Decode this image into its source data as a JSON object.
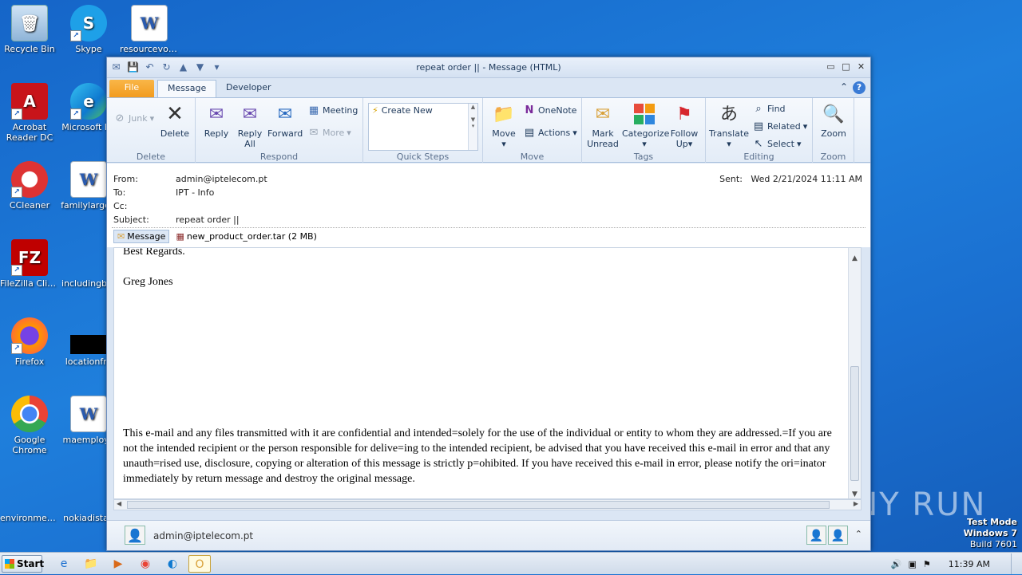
{
  "desktop": {
    "icons": [
      {
        "label": "Recycle Bin"
      },
      {
        "label": "Skype"
      },
      {
        "label": "resourcevol..."
      },
      {
        "label": "Acrobat Reader DC"
      },
      {
        "label": "Microsoft Ed"
      },
      {
        "label": "CCleaner"
      },
      {
        "label": "familylarge.r"
      },
      {
        "label": "FileZilla Client"
      },
      {
        "label": "includingbro"
      },
      {
        "label": "Firefox"
      },
      {
        "label": "locationfro"
      },
      {
        "label": "Google Chrome"
      },
      {
        "label": "maemploye"
      },
      {
        "label": "environmen..."
      },
      {
        "label": "nokiadistan"
      }
    ],
    "watermark": "ANY RUN",
    "test_mode": {
      "line1": "Test Mode",
      "line2": "Windows 7",
      "line3": "Build 7601"
    }
  },
  "window": {
    "title": "repeat order ||   -  Message (HTML)",
    "tabs": {
      "file": "File",
      "message": "Message",
      "developer": "Developer"
    },
    "ribbon": {
      "delete_group": {
        "junk": "Junk",
        "delete": "Delete",
        "label": "Delete"
      },
      "respond_group": {
        "reply": "Reply",
        "reply_all_1": "Reply",
        "reply_all_2": "All",
        "forward": "Forward",
        "meeting": "Meeting",
        "more": "More",
        "label": "Respond"
      },
      "quick_steps": {
        "create_new": "Create New",
        "label": "Quick Steps"
      },
      "move_group": {
        "move": "Move",
        "onenote": "OneNote",
        "actions": "Actions",
        "label": "Move"
      },
      "tags_group": {
        "mark_unread_1": "Mark",
        "mark_unread_2": "Unread",
        "categorize": "Categorize",
        "follow_up_1": "Follow",
        "follow_up_2": "Up",
        "label": "Tags"
      },
      "editing_group": {
        "translate": "Translate",
        "find": "Find",
        "related": "Related",
        "select": "Select",
        "label": "Editing"
      },
      "zoom_group": {
        "zoom": "Zoom",
        "label": "Zoom"
      }
    },
    "header": {
      "from_label": "From:",
      "from": "admin@iptelecom.pt",
      "to_label": "To:",
      "to": "IPT - Info",
      "cc_label": "Cc:",
      "cc": "",
      "subject_label": "Subject:",
      "subject": "repeat order ||",
      "sent_label": "Sent:",
      "sent": "Wed 2/21/2024 11:11 AM",
      "message_tab": "Message",
      "attachment": "new_product_order.tar (2 MB)"
    },
    "body": {
      "regards": "Best Regards.",
      "signature": "Greg Jones",
      "disclaimer": "This e-mail and any files transmitted with it are confidential and intended=solely for the use of the individual or entity to whom they are addressed.=If you are not the intended recipient or the person responsible for delive=ing to the intended recipient, be advised that you have received this e-mail in error and that any unauth=rised use, disclosure, copying or alteration of this message is strictly p=ohibited. If you have received this e-mail in error, please notify the ori=inator immediately by return message and destroy the original message."
    },
    "people_pane": {
      "address": "admin@iptelecom.pt"
    }
  },
  "taskbar": {
    "start": "Start",
    "clock": "11:39 AM"
  }
}
